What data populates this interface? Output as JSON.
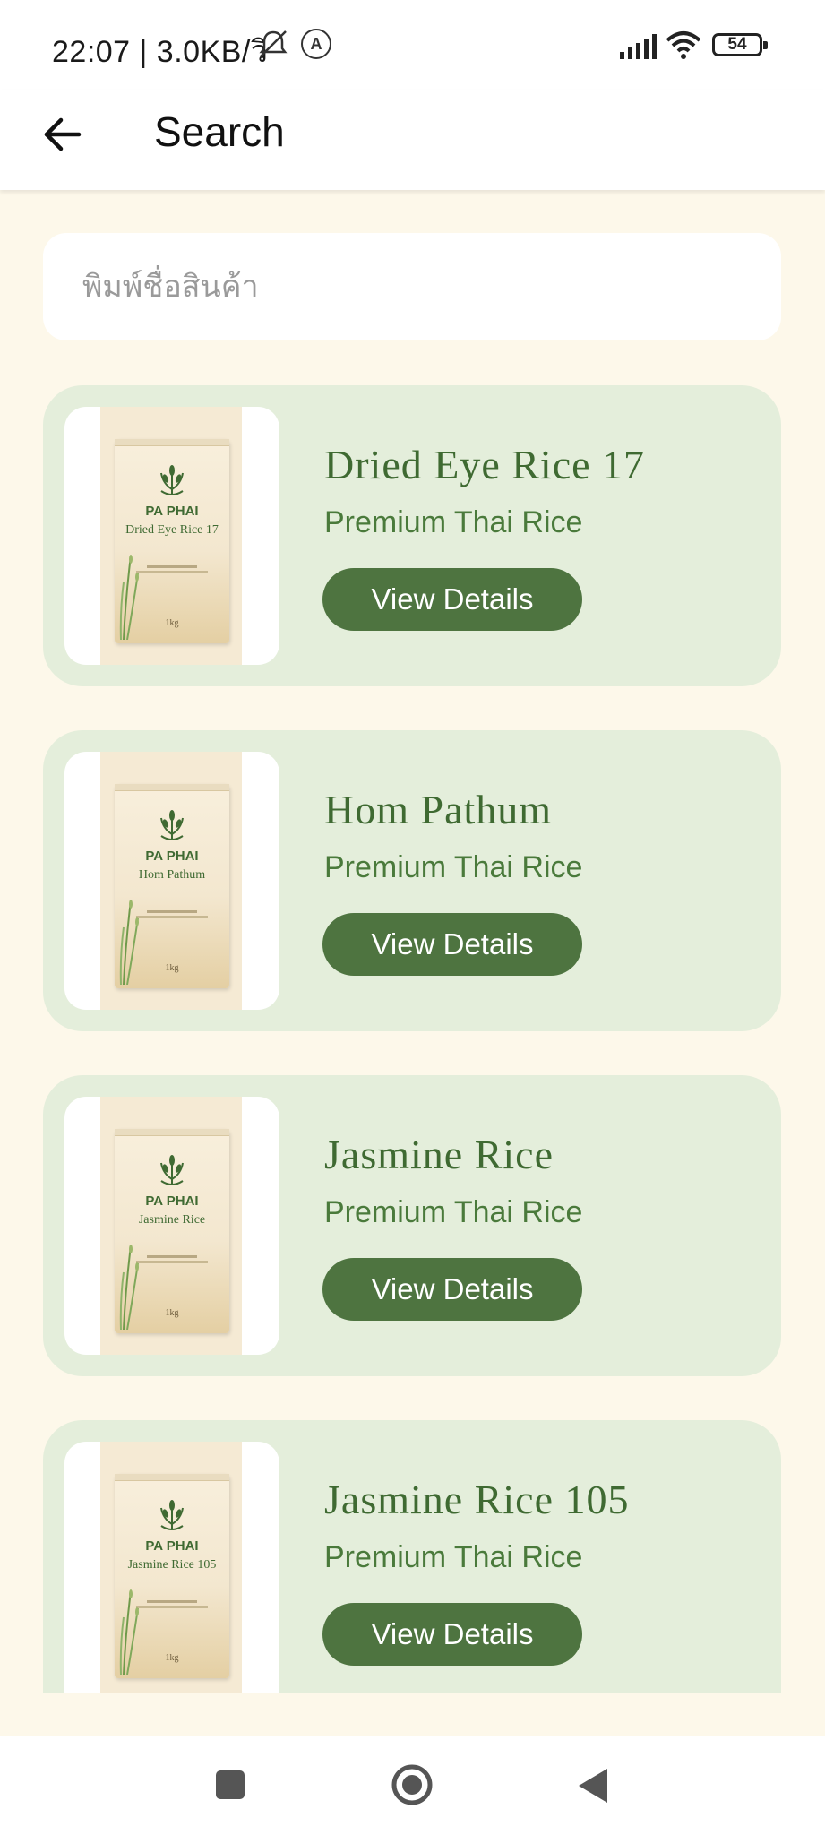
{
  "status_bar": {
    "text": "22:07 | 3.0KB/วิ",
    "battery": "54",
    "circle_badge": "A"
  },
  "app_bar": {
    "title": "Search",
    "back_icon": "arrow-left-icon"
  },
  "search": {
    "placeholder": "พิมพ์ชื่อสินค้า",
    "value": ""
  },
  "products": [
    {
      "title": "Dried Eye Rice 17",
      "subtitle": "Premium Thai Rice",
      "button": "View Details",
      "bag_brand": "PA PHAI",
      "bag_name": "Dried Eye Rice 17",
      "bag_weight": "1kg"
    },
    {
      "title": "Hom Pathum",
      "subtitle": "Premium Thai Rice",
      "button": "View Details",
      "bag_brand": "PA PHAI",
      "bag_name": "Hom Pathum",
      "bag_weight": "1kg"
    },
    {
      "title": "Jasmine Rice",
      "subtitle": "Premium Thai Rice",
      "button": "View Details",
      "bag_brand": "PA PHAI",
      "bag_name": "Jasmine Rice",
      "bag_weight": "1kg"
    },
    {
      "title": "Jasmine Rice 105",
      "subtitle": "Premium Thai Rice",
      "button": "View Details",
      "bag_brand": "PA PHAI",
      "bag_name": "Jasmine Rice 105",
      "bag_weight": "1kg"
    }
  ],
  "colors": {
    "background": "#fdf8ea",
    "card": "#e4eedb",
    "accent": "#4e7440",
    "title_green": "#3f6a32"
  },
  "nav": {
    "icons": [
      "recent-apps-icon",
      "home-icon",
      "back-triangle-icon"
    ]
  }
}
